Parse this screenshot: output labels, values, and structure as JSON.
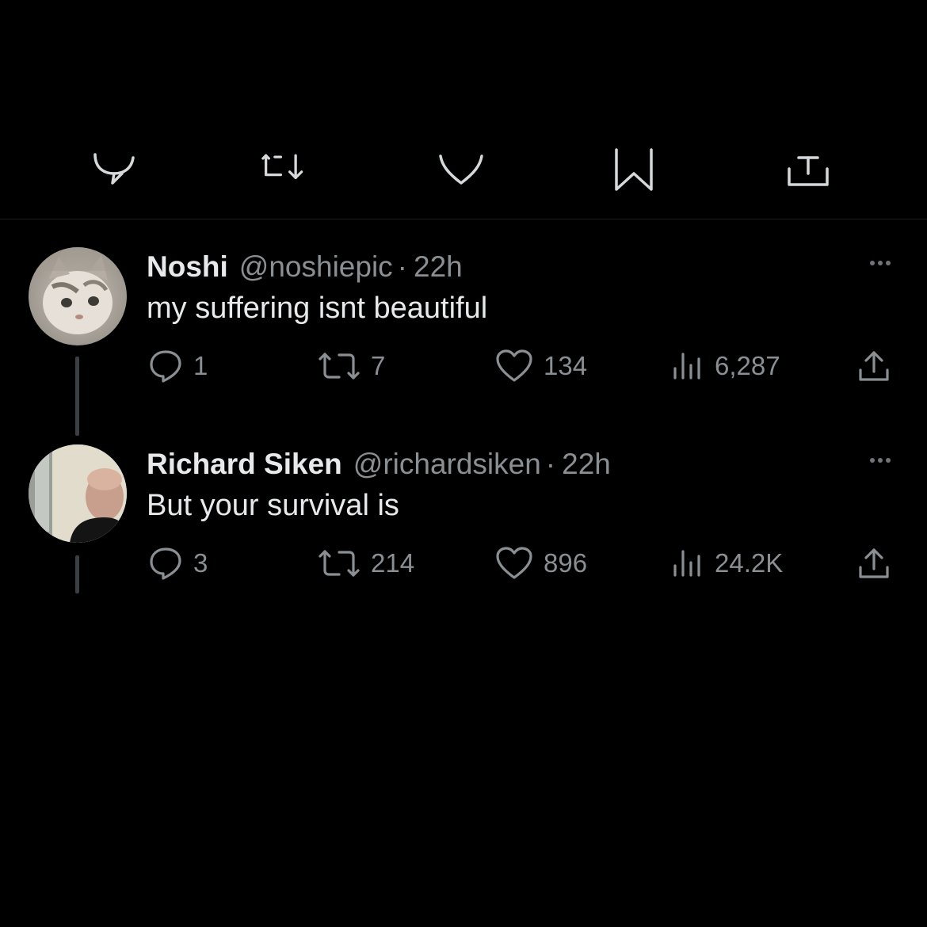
{
  "top_actions": {
    "icons": [
      "reply-icon",
      "retweet-icon",
      "like-icon",
      "bookmark-icon",
      "share-icon"
    ]
  },
  "tweets": [
    {
      "display_name": "Noshi",
      "handle": "@noshiepic",
      "separator": "·",
      "time": "22h",
      "text": "my suffering isnt beautiful",
      "avatar": "cat-avatar",
      "stats": {
        "replies": "1",
        "retweets": "7",
        "likes": "134",
        "views": "6,287"
      }
    },
    {
      "display_name": "Richard Siken",
      "handle": "@richardsiken",
      "separator": "·",
      "time": "22h",
      "text": "But your survival is",
      "avatar": "person-avatar",
      "stats": {
        "replies": "3",
        "retweets": "214",
        "likes": "896",
        "views": "24.2K"
      }
    }
  ],
  "colors": {
    "background": "#000000",
    "primary_text": "#e7e9ea",
    "secondary_text": "#8a8f94",
    "thread_line": "#3b3f43"
  }
}
